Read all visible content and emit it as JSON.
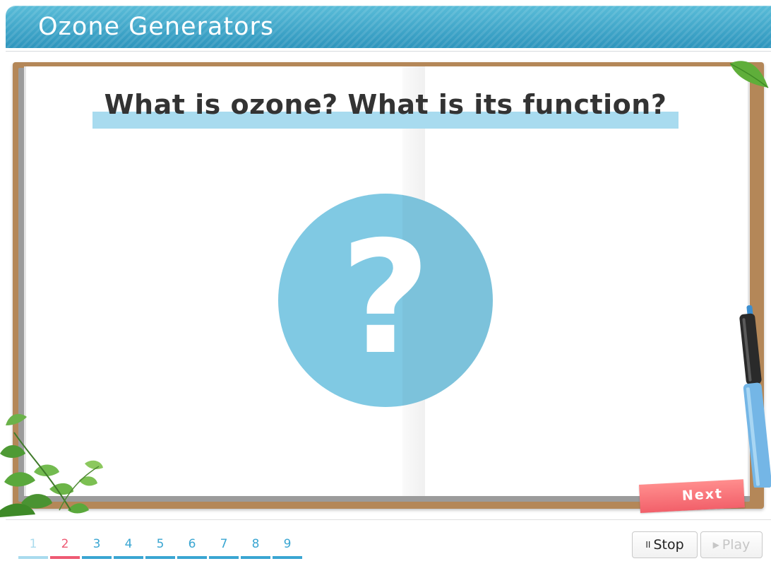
{
  "header": {
    "title": "Ozone Generators"
  },
  "slide": {
    "question": "What is ozone? What is its function?",
    "symbol": "?",
    "next_label": "Next"
  },
  "pagination": {
    "current": 2,
    "pages": [
      {
        "label": "1",
        "state": "visited"
      },
      {
        "label": "2",
        "state": "current"
      },
      {
        "label": "3",
        "state": "default"
      },
      {
        "label": "4",
        "state": "default"
      },
      {
        "label": "5",
        "state": "default"
      },
      {
        "label": "6",
        "state": "default"
      },
      {
        "label": "7",
        "state": "default"
      },
      {
        "label": "8",
        "state": "default"
      },
      {
        "label": "9",
        "state": "default"
      }
    ]
  },
  "controls": {
    "stop": {
      "icon": "pause-icon",
      "label": "Stop",
      "glyph": "II",
      "enabled": true
    },
    "play": {
      "icon": "play-icon",
      "label": "Play",
      "glyph": "▶",
      "enabled": false
    }
  },
  "colors": {
    "header": "#3aa6d2",
    "accent_blue": "#80c9e3",
    "highlight": "#a8dbef",
    "current_page": "#ee5a73",
    "next_ribbon": "#f2606a",
    "book_cover": "#b48758"
  }
}
